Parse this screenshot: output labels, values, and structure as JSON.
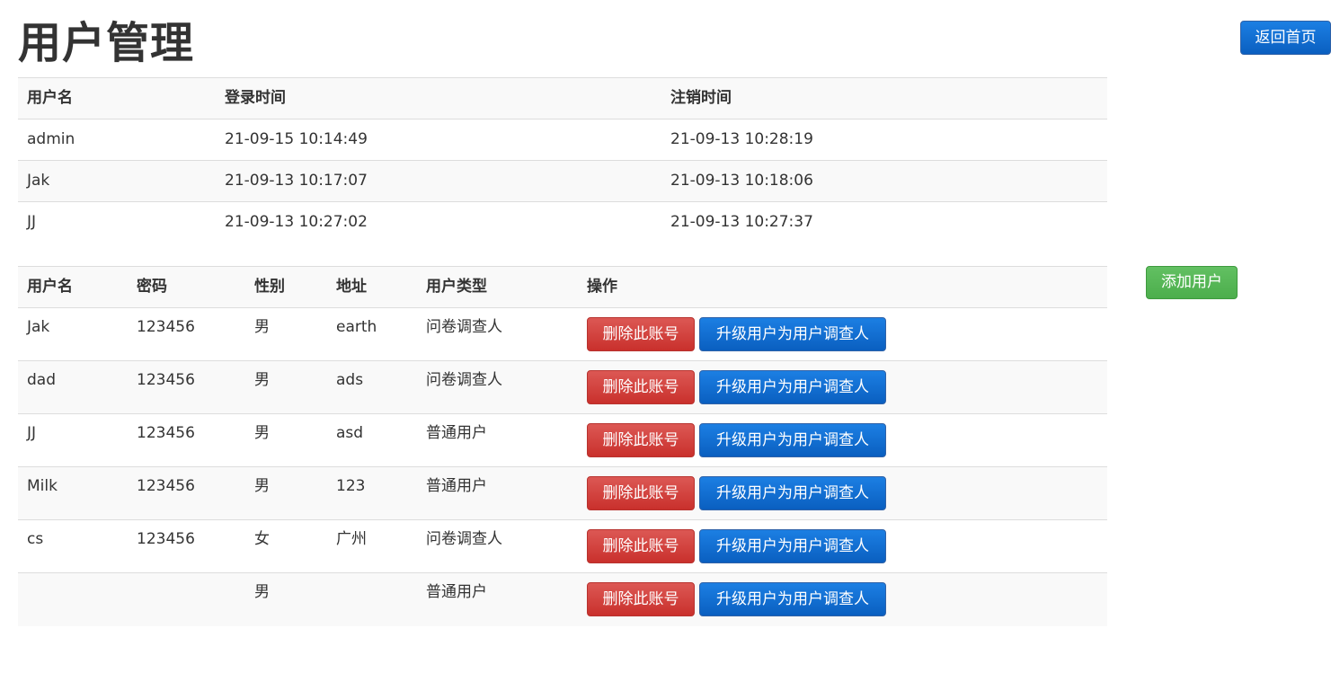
{
  "page": {
    "title": "用户管理",
    "home_button": "返回首页",
    "add_user_button": "添加用户"
  },
  "login_table": {
    "headers": [
      "用户名",
      "登录时间",
      "注销时间"
    ],
    "rows": [
      [
        "admin",
        "21-09-15 10:14:49",
        "21-09-13 10:28:19"
      ],
      [
        "Jak",
        "21-09-13 10:17:07",
        "21-09-13 10:18:06"
      ],
      [
        "JJ",
        "21-09-13 10:27:02",
        "21-09-13 10:27:37"
      ]
    ]
  },
  "user_table": {
    "headers": [
      "用户名",
      "密码",
      "性别",
      "地址",
      "用户类型",
      "操作"
    ],
    "delete_label": "删除此账号",
    "upgrade_label": "升级用户为用户调查人",
    "rows": [
      [
        "Jak",
        "123456",
        "男",
        "earth",
        "问卷调查人"
      ],
      [
        "dad",
        "123456",
        "男",
        "ads",
        "问卷调查人"
      ],
      [
        "JJ",
        "123456",
        "男",
        "asd",
        "普通用户"
      ],
      [
        "Milk",
        "123456",
        "男",
        "123",
        "普通用户"
      ],
      [
        "cs",
        "123456",
        "女",
        "广州",
        "问卷调查人"
      ],
      [
        "",
        "",
        "男",
        "",
        "普通用户"
      ]
    ]
  }
}
